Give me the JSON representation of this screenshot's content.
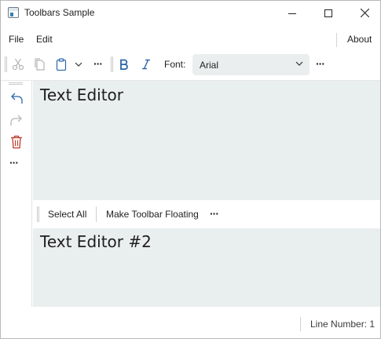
{
  "window": {
    "title": "Toolbars Sample"
  },
  "menu": {
    "file": "File",
    "edit": "Edit",
    "about": "About"
  },
  "toolbar": {
    "more": "···",
    "font_label": "Font:",
    "font_value": "Arial"
  },
  "vertical_toolbar": {
    "more": "···"
  },
  "editor1": {
    "text": "Text Editor"
  },
  "floating_toolbar": {
    "select_all": "Select All",
    "make_floating": "Make Toolbar Floating",
    "more": "···"
  },
  "editor2": {
    "text": "Text Editor #2"
  },
  "status": {
    "line_number": "Line Number: 1"
  },
  "colors": {
    "accent": "#2b66a8",
    "delete": "#c0392b",
    "editor_bg": "#e9eeee"
  }
}
